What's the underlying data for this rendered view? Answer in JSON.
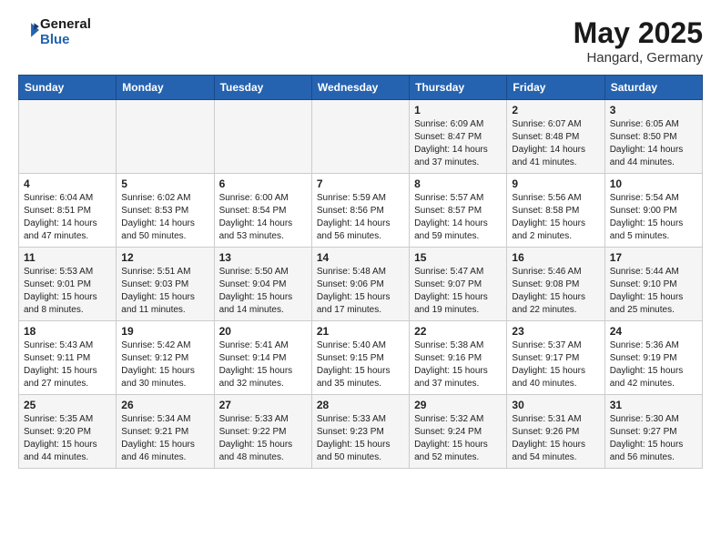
{
  "header": {
    "logo_line1": "General",
    "logo_line2": "Blue",
    "month_year": "May 2025",
    "location": "Hangard, Germany"
  },
  "weekdays": [
    "Sunday",
    "Monday",
    "Tuesday",
    "Wednesday",
    "Thursday",
    "Friday",
    "Saturday"
  ],
  "weeks": [
    [
      {
        "day": "",
        "info": ""
      },
      {
        "day": "",
        "info": ""
      },
      {
        "day": "",
        "info": ""
      },
      {
        "day": "",
        "info": ""
      },
      {
        "day": "1",
        "info": "Sunrise: 6:09 AM\nSunset: 8:47 PM\nDaylight: 14 hours\nand 37 minutes."
      },
      {
        "day": "2",
        "info": "Sunrise: 6:07 AM\nSunset: 8:48 PM\nDaylight: 14 hours\nand 41 minutes."
      },
      {
        "day": "3",
        "info": "Sunrise: 6:05 AM\nSunset: 8:50 PM\nDaylight: 14 hours\nand 44 minutes."
      }
    ],
    [
      {
        "day": "4",
        "info": "Sunrise: 6:04 AM\nSunset: 8:51 PM\nDaylight: 14 hours\nand 47 minutes."
      },
      {
        "day": "5",
        "info": "Sunrise: 6:02 AM\nSunset: 8:53 PM\nDaylight: 14 hours\nand 50 minutes."
      },
      {
        "day": "6",
        "info": "Sunrise: 6:00 AM\nSunset: 8:54 PM\nDaylight: 14 hours\nand 53 minutes."
      },
      {
        "day": "7",
        "info": "Sunrise: 5:59 AM\nSunset: 8:56 PM\nDaylight: 14 hours\nand 56 minutes."
      },
      {
        "day": "8",
        "info": "Sunrise: 5:57 AM\nSunset: 8:57 PM\nDaylight: 14 hours\nand 59 minutes."
      },
      {
        "day": "9",
        "info": "Sunrise: 5:56 AM\nSunset: 8:58 PM\nDaylight: 15 hours\nand 2 minutes."
      },
      {
        "day": "10",
        "info": "Sunrise: 5:54 AM\nSunset: 9:00 PM\nDaylight: 15 hours\nand 5 minutes."
      }
    ],
    [
      {
        "day": "11",
        "info": "Sunrise: 5:53 AM\nSunset: 9:01 PM\nDaylight: 15 hours\nand 8 minutes."
      },
      {
        "day": "12",
        "info": "Sunrise: 5:51 AM\nSunset: 9:03 PM\nDaylight: 15 hours\nand 11 minutes."
      },
      {
        "day": "13",
        "info": "Sunrise: 5:50 AM\nSunset: 9:04 PM\nDaylight: 15 hours\nand 14 minutes."
      },
      {
        "day": "14",
        "info": "Sunrise: 5:48 AM\nSunset: 9:06 PM\nDaylight: 15 hours\nand 17 minutes."
      },
      {
        "day": "15",
        "info": "Sunrise: 5:47 AM\nSunset: 9:07 PM\nDaylight: 15 hours\nand 19 minutes."
      },
      {
        "day": "16",
        "info": "Sunrise: 5:46 AM\nSunset: 9:08 PM\nDaylight: 15 hours\nand 22 minutes."
      },
      {
        "day": "17",
        "info": "Sunrise: 5:44 AM\nSunset: 9:10 PM\nDaylight: 15 hours\nand 25 minutes."
      }
    ],
    [
      {
        "day": "18",
        "info": "Sunrise: 5:43 AM\nSunset: 9:11 PM\nDaylight: 15 hours\nand 27 minutes."
      },
      {
        "day": "19",
        "info": "Sunrise: 5:42 AM\nSunset: 9:12 PM\nDaylight: 15 hours\nand 30 minutes."
      },
      {
        "day": "20",
        "info": "Sunrise: 5:41 AM\nSunset: 9:14 PM\nDaylight: 15 hours\nand 32 minutes."
      },
      {
        "day": "21",
        "info": "Sunrise: 5:40 AM\nSunset: 9:15 PM\nDaylight: 15 hours\nand 35 minutes."
      },
      {
        "day": "22",
        "info": "Sunrise: 5:38 AM\nSunset: 9:16 PM\nDaylight: 15 hours\nand 37 minutes."
      },
      {
        "day": "23",
        "info": "Sunrise: 5:37 AM\nSunset: 9:17 PM\nDaylight: 15 hours\nand 40 minutes."
      },
      {
        "day": "24",
        "info": "Sunrise: 5:36 AM\nSunset: 9:19 PM\nDaylight: 15 hours\nand 42 minutes."
      }
    ],
    [
      {
        "day": "25",
        "info": "Sunrise: 5:35 AM\nSunset: 9:20 PM\nDaylight: 15 hours\nand 44 minutes."
      },
      {
        "day": "26",
        "info": "Sunrise: 5:34 AM\nSunset: 9:21 PM\nDaylight: 15 hours\nand 46 minutes."
      },
      {
        "day": "27",
        "info": "Sunrise: 5:33 AM\nSunset: 9:22 PM\nDaylight: 15 hours\nand 48 minutes."
      },
      {
        "day": "28",
        "info": "Sunrise: 5:33 AM\nSunset: 9:23 PM\nDaylight: 15 hours\nand 50 minutes."
      },
      {
        "day": "29",
        "info": "Sunrise: 5:32 AM\nSunset: 9:24 PM\nDaylight: 15 hours\nand 52 minutes."
      },
      {
        "day": "30",
        "info": "Sunrise: 5:31 AM\nSunset: 9:26 PM\nDaylight: 15 hours\nand 54 minutes."
      },
      {
        "day": "31",
        "info": "Sunrise: 5:30 AM\nSunset: 9:27 PM\nDaylight: 15 hours\nand 56 minutes."
      }
    ]
  ]
}
